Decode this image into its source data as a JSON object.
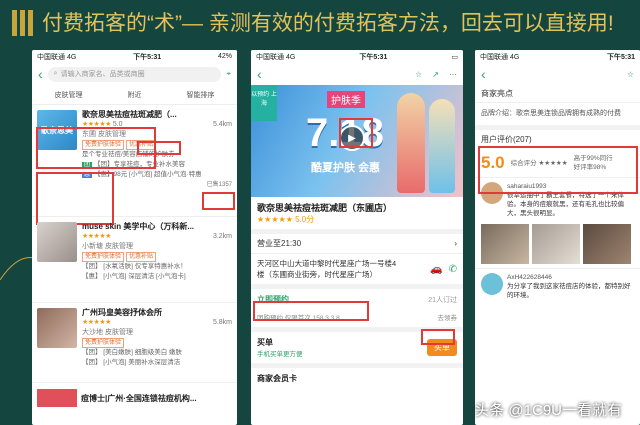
{
  "slide": {
    "title": "付费拓客的“术”— 亲测有效的付费拓客方法，回去可以直接用!",
    "accent": "#c9a43a",
    "background": "#14463f"
  },
  "watermark": "头条 @1C9U一看就有",
  "phone1": {
    "status": {
      "carrier": "中国联通  4G",
      "time": "下午5:31",
      "battery": "42%"
    },
    "search_placeholder": "请输入商家名、品类或商圈",
    "filters": [
      "皮肤管理",
      "附近",
      "智能排序"
    ],
    "shops": [
      {
        "name": "歌奈思美祛痘祛斑减肥（...",
        "thumb_text": "歌奈思美",
        "stars": "★★★★★",
        "score": "5.0",
        "distance": "5.4km",
        "category": "东圃  皮肤管理",
        "tags": [
          "免费护肤体验",
          "优惠补贴"
        ],
        "deals": [
          "是个专业祛痘/美容店铺的护肤券",
          "【团】专享祛痘，专业补水美容",
          "【惠】98元 [小气泡] 超值小气泡·特惠"
        ],
        "sold": "已售1357"
      },
      {
        "name": "muse skin 美学中心（万科新...",
        "stars": "★★★★★",
        "distance": "3.2km",
        "category": "小新塘  皮肤管理",
        "tags": [
          "免费护肤体验",
          "优惠补贴"
        ],
        "deals": [
          "【团】 [水氧活肤] 仅专享特惠补水！",
          "【惠】 [小气泡] 深层清洁 [小气泡卡]"
        ]
      },
      {
        "name": "广州玛皇美容抒体会所",
        "stars": "★★★★★",
        "distance": "5.8km",
        "category": "大沙地  皮肤管理",
        "tags": [
          "免费护肤体验"
        ],
        "deals": [
          "【团】 [美白嫩肤] 细胞级美白 嫩肤",
          "【团】 [小气泡] 美丽补水深层清洁"
        ]
      }
    ],
    "bottom_item": "痘博士|广州·全国连锁祛痘机构..."
  },
  "phone2": {
    "status": {
      "carrier": "中国联通  4G",
      "time": "下午5:31"
    },
    "banner": {
      "season": "护肤季",
      "big": "7.18",
      "sub": "酷夏护肤  会惠",
      "left_tag": "以预约\n上海"
    },
    "shop_name": "歌奈思美祛痘祛斑减肥（东圃店）",
    "stars": "★★★★★",
    "score": "5.0分",
    "hours": "营业至21:30",
    "address": "天河区中山大道中黎时代星座广场一号楼4楼（东圃商业街旁，时代星座广场）",
    "reserve": {
      "label": "立即预约",
      "muted": "21人订过"
    },
    "small": {
      "left": "团购预约 仅限首次 158,3 3 8",
      "right": "去领券"
    },
    "buy": {
      "label": "买单",
      "hint": "手机买单更方便",
      "button": "买单"
    },
    "member": "商家会员卡"
  },
  "phone3": {
    "status": {
      "carrier": "中国联通  4G",
      "time": "下午5:31"
    },
    "section": "商家亮点",
    "brand": "品牌介绍：歌奈思美连锁品牌拥有成熟的付费",
    "review_title": "用户评价(207)",
    "score": "5.0",
    "score_mid": "综合评分 ★★★★★",
    "score_right_1": "高于99%同行",
    "score_right_2": "好评率98%",
    "reviews": [
      {
        "name": "saharaiu1993",
        "text": "很幸运抽中了霸王套餐，特选了一个来体验。本身的痘痕就黑，还有毛孔也比较偏大，黑头很明显。"
      },
      {
        "name": "AxH422628446",
        "text": "为分享了我到这家祛痘店的体验，都特别好的环境。"
      }
    ]
  }
}
